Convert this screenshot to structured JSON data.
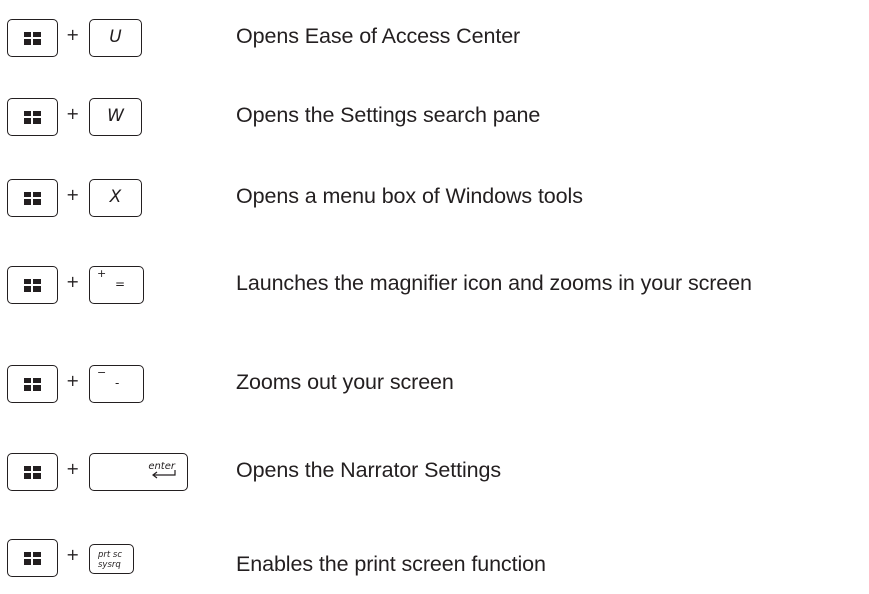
{
  "plus_symbol": "+",
  "shortcuts": [
    {
      "key": "U",
      "description": "Opens Ease of Access Center"
    },
    {
      "key": "W",
      "description": "Opens the Settings search pane"
    },
    {
      "key": "X",
      "description": "Opens a menu box of Windows tools"
    },
    {
      "key_top": "+",
      "key_main": "=",
      "description": "Launches the magnifier icon and zooms in your screen"
    },
    {
      "key_top": "−",
      "key_main": "-",
      "description": "Zooms out your screen"
    },
    {
      "key_label": "enter",
      "description": "Opens the Narrator Settings"
    },
    {
      "key_line1": "prt sc",
      "key_line2": "sysrq",
      "description": "Enables the print screen function"
    }
  ],
  "icons": {
    "windows_key": "windows-logo-icon",
    "enter_arrow": "enter-arrow-icon"
  }
}
